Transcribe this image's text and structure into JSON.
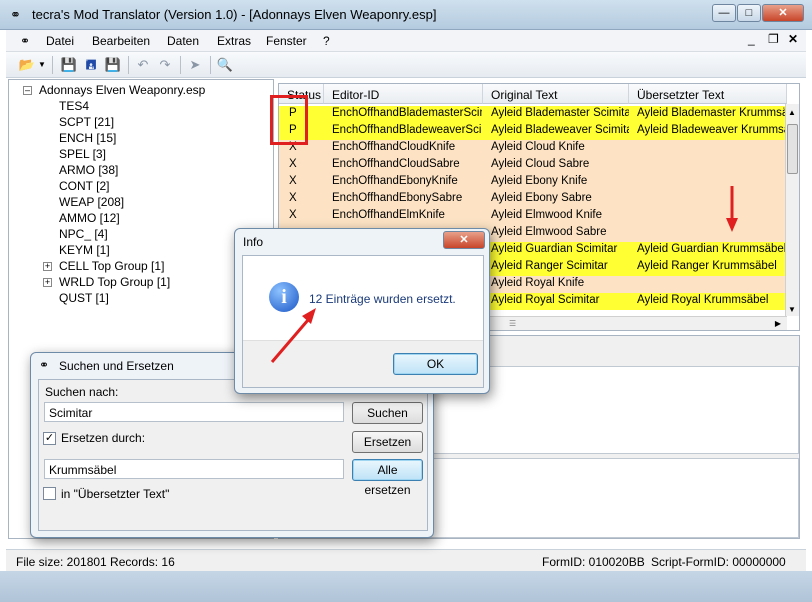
{
  "window": {
    "title": "tecra's Mod Translator (Version 1.0) - [Adonnays Elven Weaponry.esp]",
    "icon": "app-icon"
  },
  "menu": [
    "Datei",
    "Bearbeiten",
    "Daten",
    "Extras",
    "Fenster",
    "?"
  ],
  "tree": {
    "root": "Adonnays Elven Weaponry.esp",
    "items": [
      "TES4",
      "SCPT [21]",
      "ENCH [15]",
      "SPEL [3]",
      "ARMO [38]",
      "CONT [2]",
      "WEAP [208]",
      "AMMO [12]",
      "NPC_ [4]",
      "KEYM [1]",
      "CELL Top Group [1]",
      "WRLD Top Group [1]",
      "QUST [1]"
    ]
  },
  "grid": {
    "headers": [
      "Status",
      "Editor-ID",
      "Original Text",
      "Übersetzter Text"
    ],
    "rows": [
      {
        "status": "P",
        "editor_id": "EnchOffhandBlademasterScim",
        "original": "Ayleid Blademaster Scimitar",
        "translated": "Ayleid Blademaster Krummsäbel",
        "highlight": true
      },
      {
        "status": "P",
        "editor_id": "EnchOffhandBladeweaverScim",
        "original": "Ayleid Bladeweaver Scimitar",
        "translated": "Ayleid Bladeweaver Krummsäbel",
        "highlight": true
      },
      {
        "status": "X",
        "editor_id": "EnchOffhandCloudKnife",
        "original": "Ayleid Cloud Knife",
        "translated": "",
        "highlight": false
      },
      {
        "status": "X",
        "editor_id": "EnchOffhandCloudSabre",
        "original": "Ayleid Cloud Sabre",
        "translated": "",
        "highlight": false
      },
      {
        "status": "X",
        "editor_id": "EnchOffhandEbonyKnife",
        "original": "Ayleid Ebony Knife",
        "translated": "",
        "highlight": false
      },
      {
        "status": "X",
        "editor_id": "EnchOffhandEbonySabre",
        "original": "Ayleid Ebony Sabre",
        "translated": "",
        "highlight": false
      },
      {
        "status": "X",
        "editor_id": "EnchOffhandElmKnife",
        "original": "Ayleid Elmwood Knife",
        "translated": "",
        "highlight": false
      },
      {
        "status": "",
        "editor_id": "",
        "original": "Ayleid Elmwood Sabre",
        "translated": "",
        "highlight": false
      },
      {
        "status": "",
        "editor_id": "",
        "original": "Ayleid Guardian Scimitar",
        "translated": "Ayleid Guardian Krummsäbel",
        "highlight": true
      },
      {
        "status": "",
        "editor_id": "",
        "original": "Ayleid Ranger Scimitar",
        "translated": "Ayleid Ranger Krummsäbel",
        "highlight": true
      },
      {
        "status": "",
        "editor_id": "",
        "original": "Ayleid Royal Knife",
        "translated": "",
        "highlight": false
      },
      {
        "status": "",
        "editor_id": "",
        "original": "Ayleid Royal Scimitar",
        "translated": "Ayleid Royal Krummsäbel",
        "highlight": true
      }
    ]
  },
  "status": {
    "left": "File size: 201801 Records: 16",
    "formid": "FormID:  010020BB",
    "script_formid": "Script-FormID:  00000000"
  },
  "search_dialog": {
    "title": "Suchen und Ersetzen",
    "search_label": "Suchen nach:",
    "search_value": "Scimitar",
    "search_button": "Suchen",
    "replace_label": "Ersetzen durch:",
    "replace_checked": true,
    "replace_value": "Krummsäbel",
    "replace_button": "Ersetzen",
    "replace_all_button": "Alle ersetzen",
    "scope_label": "in \"Übersetzter Text\"",
    "scope_checked": false
  },
  "info_dialog": {
    "title": "Info",
    "message": "12 Einträge wurden ersetzt.",
    "ok": "OK"
  },
  "colors": {
    "highlight": "#ffff33",
    "row_bg": "#fde3c4",
    "annotation": "#e02020"
  }
}
